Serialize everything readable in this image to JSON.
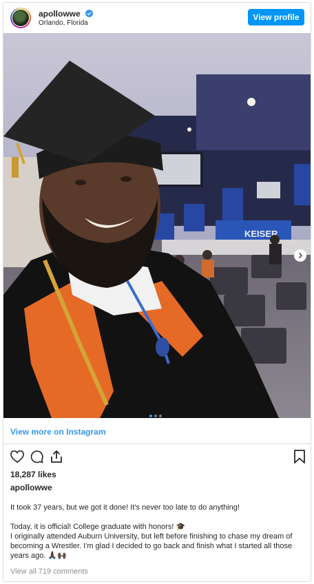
{
  "header": {
    "username": "apollowwe",
    "location": "Orlando, Florida",
    "view_profile_label": "View profile"
  },
  "photo": {
    "background_sign_text": "KEISER",
    "carousel_count": 3,
    "carousel_index": 1
  },
  "view_more_label": "View more on Instagram",
  "likes": "18,287 likes",
  "caption": {
    "username": "apollowwe",
    "line1": "It took 37 years, but we got it done! It's never too late to do anything!",
    "line2": "Today, it is official! College graduate with honors! 🎓",
    "line3": "I originally attended Auburn University, but left before finishing to chase my dream of becoming a Wrestler. I'm glad I decided to go back and finish what I started all those years ago. 🙏🏿🙌🏿"
  },
  "comments_link": "View all 719 comments",
  "colors": {
    "accent": "#0095f6",
    "link": "#3897f0",
    "text": "#262626",
    "muted": "#8e8e8e",
    "border": "#dbdbdb"
  },
  "icons": [
    "verified-badge-icon",
    "heart-icon",
    "comment-icon",
    "share-icon",
    "bookmark-icon",
    "chevron-right-icon"
  ]
}
